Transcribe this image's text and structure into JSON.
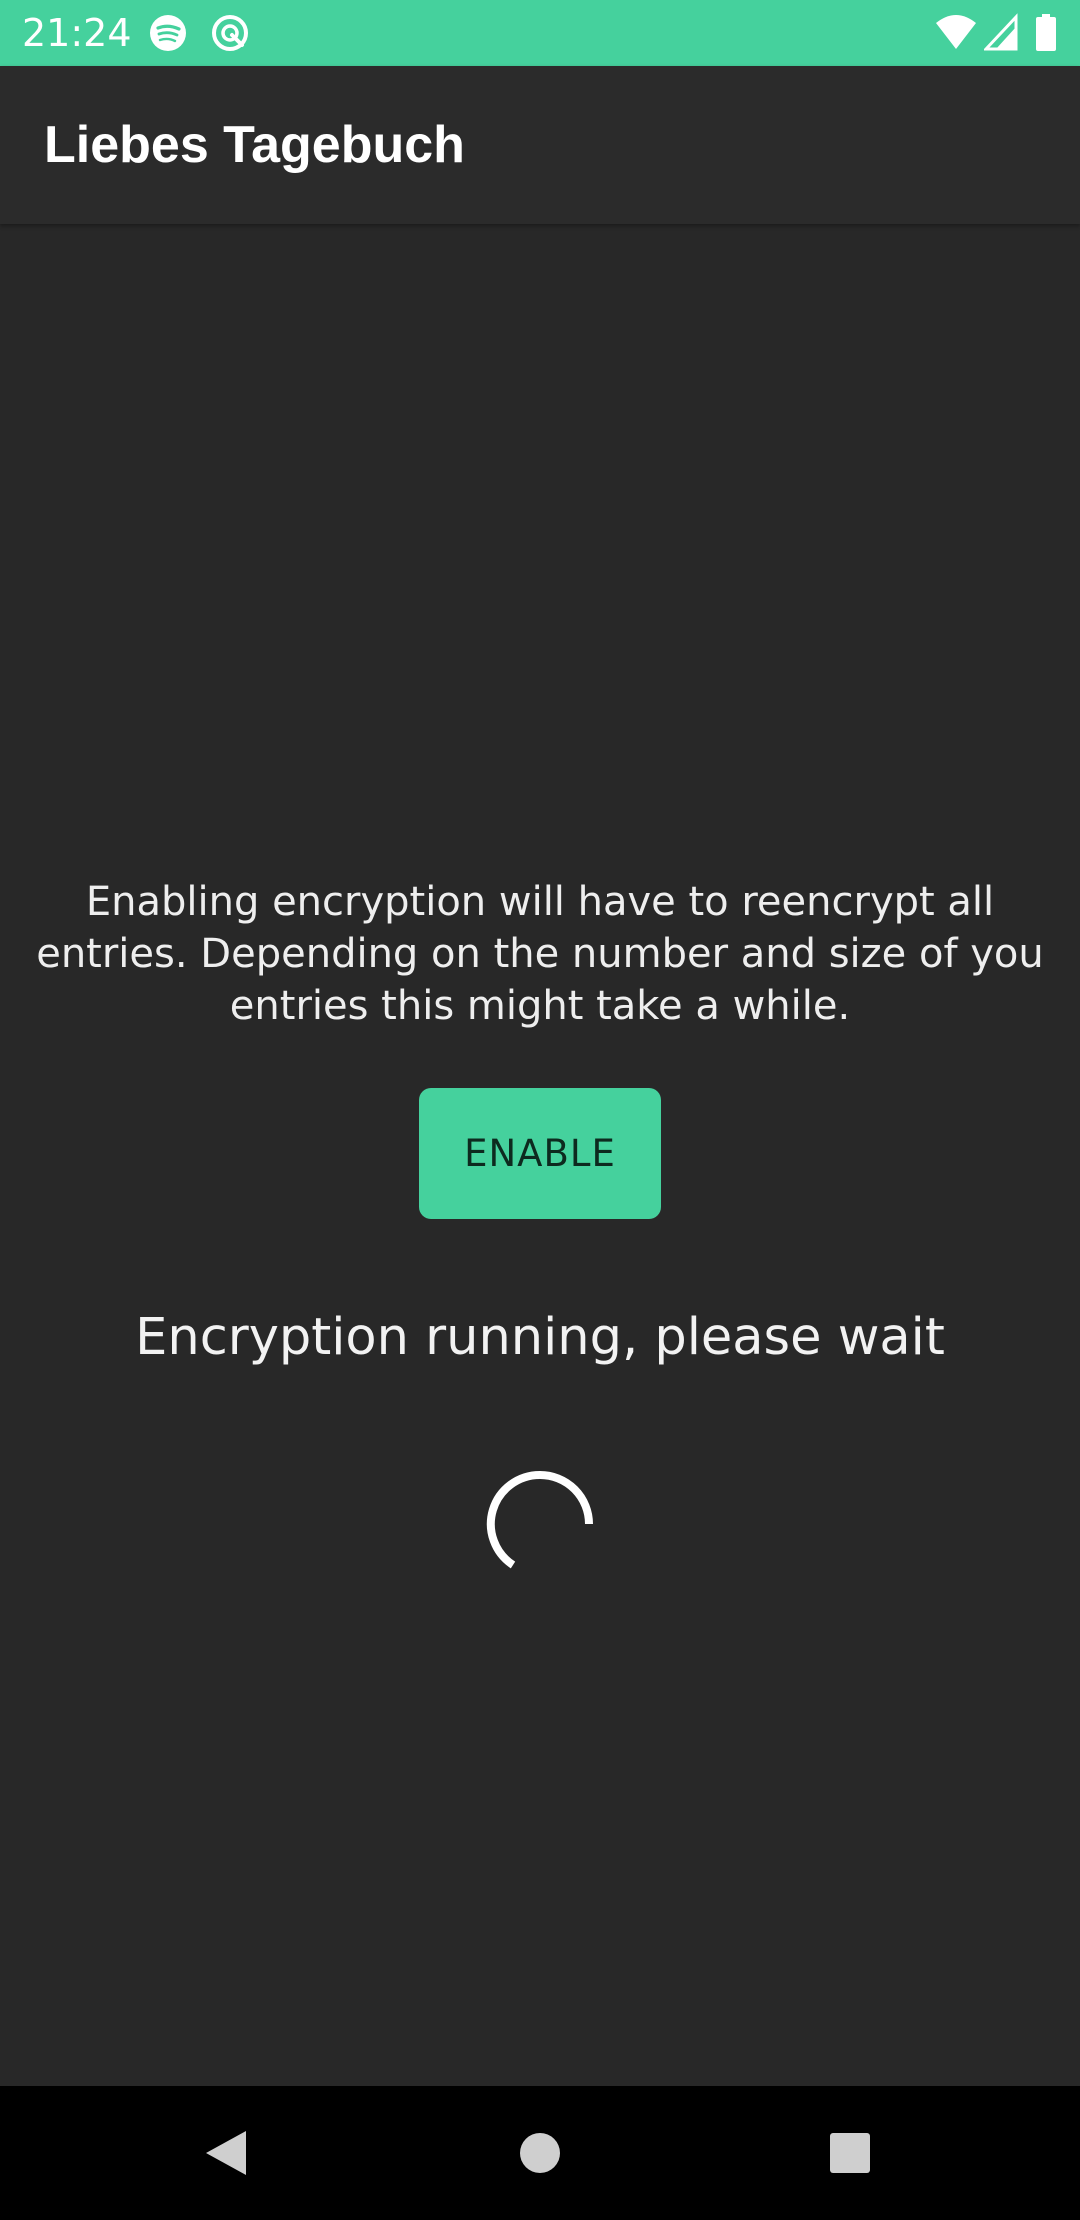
{
  "status_bar": {
    "time": "21:24",
    "icons": [
      "spotify-icon",
      "app-notification-icon",
      "wifi-icon",
      "signal-icon",
      "battery-icon"
    ],
    "background_color": "#45d19d"
  },
  "app_bar": {
    "title": "Liebes Tagebuch"
  },
  "main": {
    "info_text": "Enabling encryption will have to reencrypt all entries. Depending on the number and size of you entries this might take a while.",
    "enable_button_label": "ENABLE",
    "progress_text": "Encryption running, please wait",
    "accent_color": "#45d19d"
  },
  "nav_bar": {
    "icons": [
      "back-icon",
      "home-icon",
      "recents-icon"
    ]
  }
}
